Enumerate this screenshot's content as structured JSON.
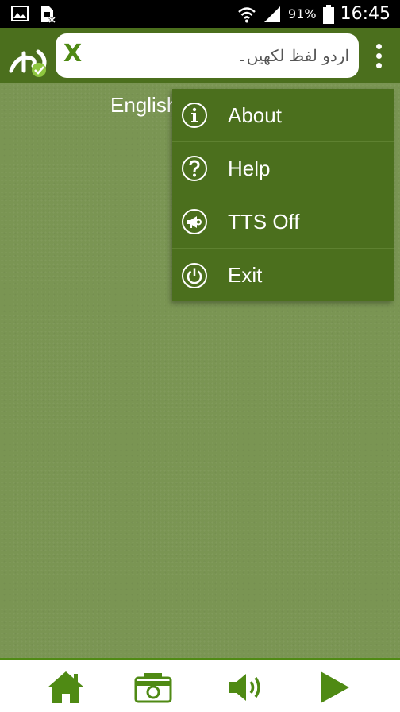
{
  "status_bar": {
    "battery_percent": "91%",
    "time": "16:45"
  },
  "app_bar": {
    "search_placeholder": "اردو لفظ لکھیں۔",
    "clear_label": "X"
  },
  "content": {
    "language_label": "English"
  },
  "menu": {
    "items": [
      {
        "label": "About",
        "icon": "info-icon"
      },
      {
        "label": "Help",
        "icon": "help-icon"
      },
      {
        "label": "TTS Off",
        "icon": "megaphone-icon"
      },
      {
        "label": "Exit",
        "icon": "power-icon"
      }
    ]
  },
  "bottom_nav": {
    "icons": [
      "home-icon",
      "camera-icon",
      "speaker-icon",
      "play-icon"
    ]
  },
  "colors": {
    "primary": "#4b6f1d",
    "accent": "#4f8a14",
    "background": "#7a9553"
  }
}
